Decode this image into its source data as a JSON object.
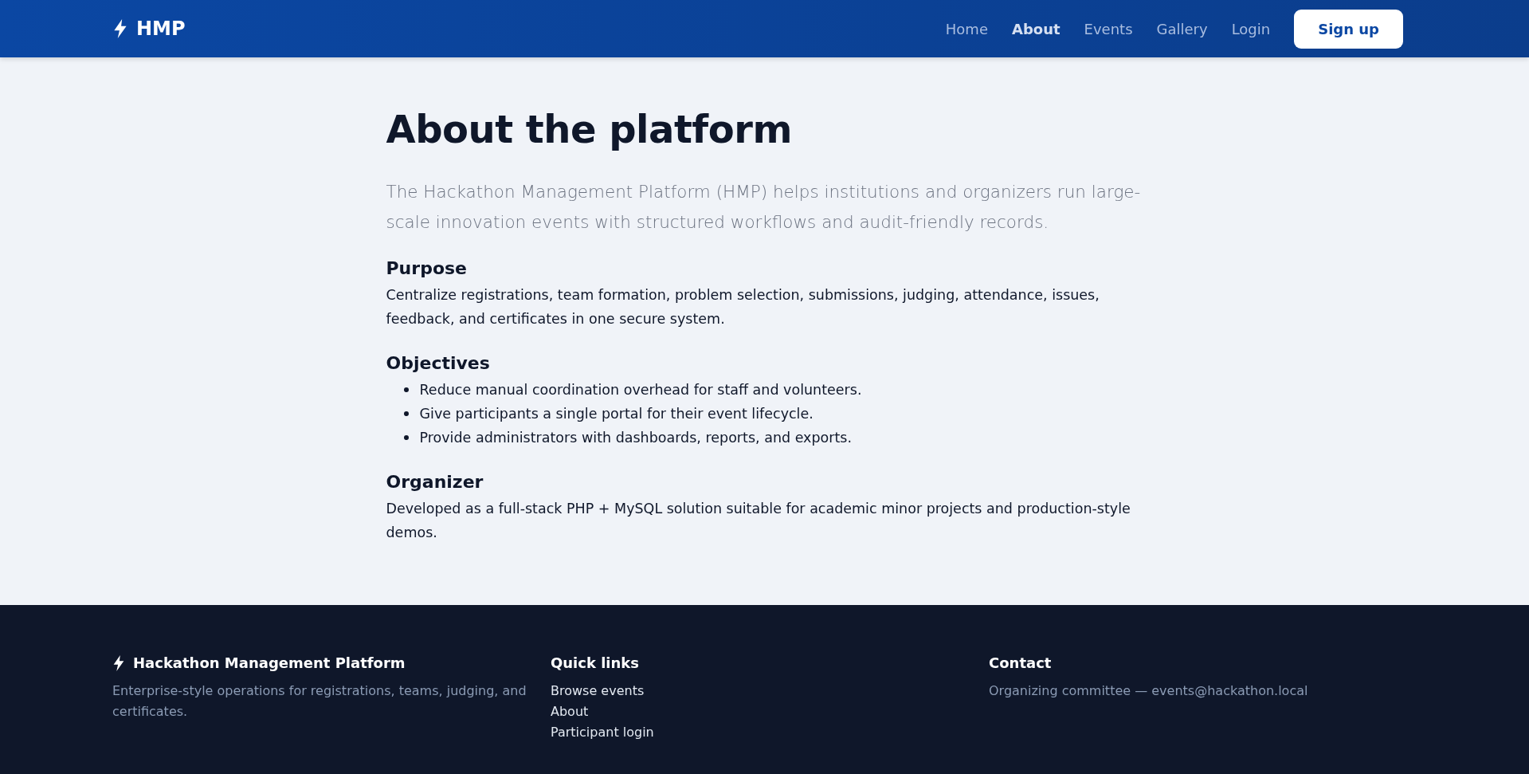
{
  "navbar": {
    "brand": "HMP",
    "links": [
      {
        "label": "Home",
        "selected": false
      },
      {
        "label": "About",
        "selected": true
      },
      {
        "label": "Events",
        "selected": false
      },
      {
        "label": "Gallery",
        "selected": false
      },
      {
        "label": "Login",
        "selected": false
      }
    ],
    "cta": "Sign up"
  },
  "main": {
    "title": "About the platform",
    "lead": "The Hackathon Management Platform (HMP) helps institutions and organizers run large-scale innovation events with structured workflows and audit-friendly records.",
    "sections": [
      {
        "kind": "paragraph",
        "heading": "Purpose",
        "text": "Centralize registrations, team formation, problem selection, submissions, judging, attendance, issues, feedback, and certificates in one secure system."
      },
      {
        "kind": "list",
        "heading": "Objectives",
        "items": [
          "Reduce manual coordination overhead for staff and volunteers.",
          "Give participants a single portal for their event lifecycle.",
          "Provide administrators with dashboards, reports, and exports."
        ]
      },
      {
        "kind": "paragraph",
        "heading": "Organizer",
        "text": "Developed as a full-stack PHP + MySQL solution suitable for academic minor projects and production-style demos."
      }
    ]
  },
  "footer": {
    "brand": "Hackathon Management Platform",
    "tagline": "Enterprise-style operations for registrations, teams, judging, and certificates.",
    "quick_links": {
      "heading": "Quick links",
      "links": [
        "Browse events",
        "About",
        "Participant login"
      ]
    },
    "contact": {
      "heading": "Contact",
      "text": "Organizing committee — events@hackathon.local"
    }
  }
}
